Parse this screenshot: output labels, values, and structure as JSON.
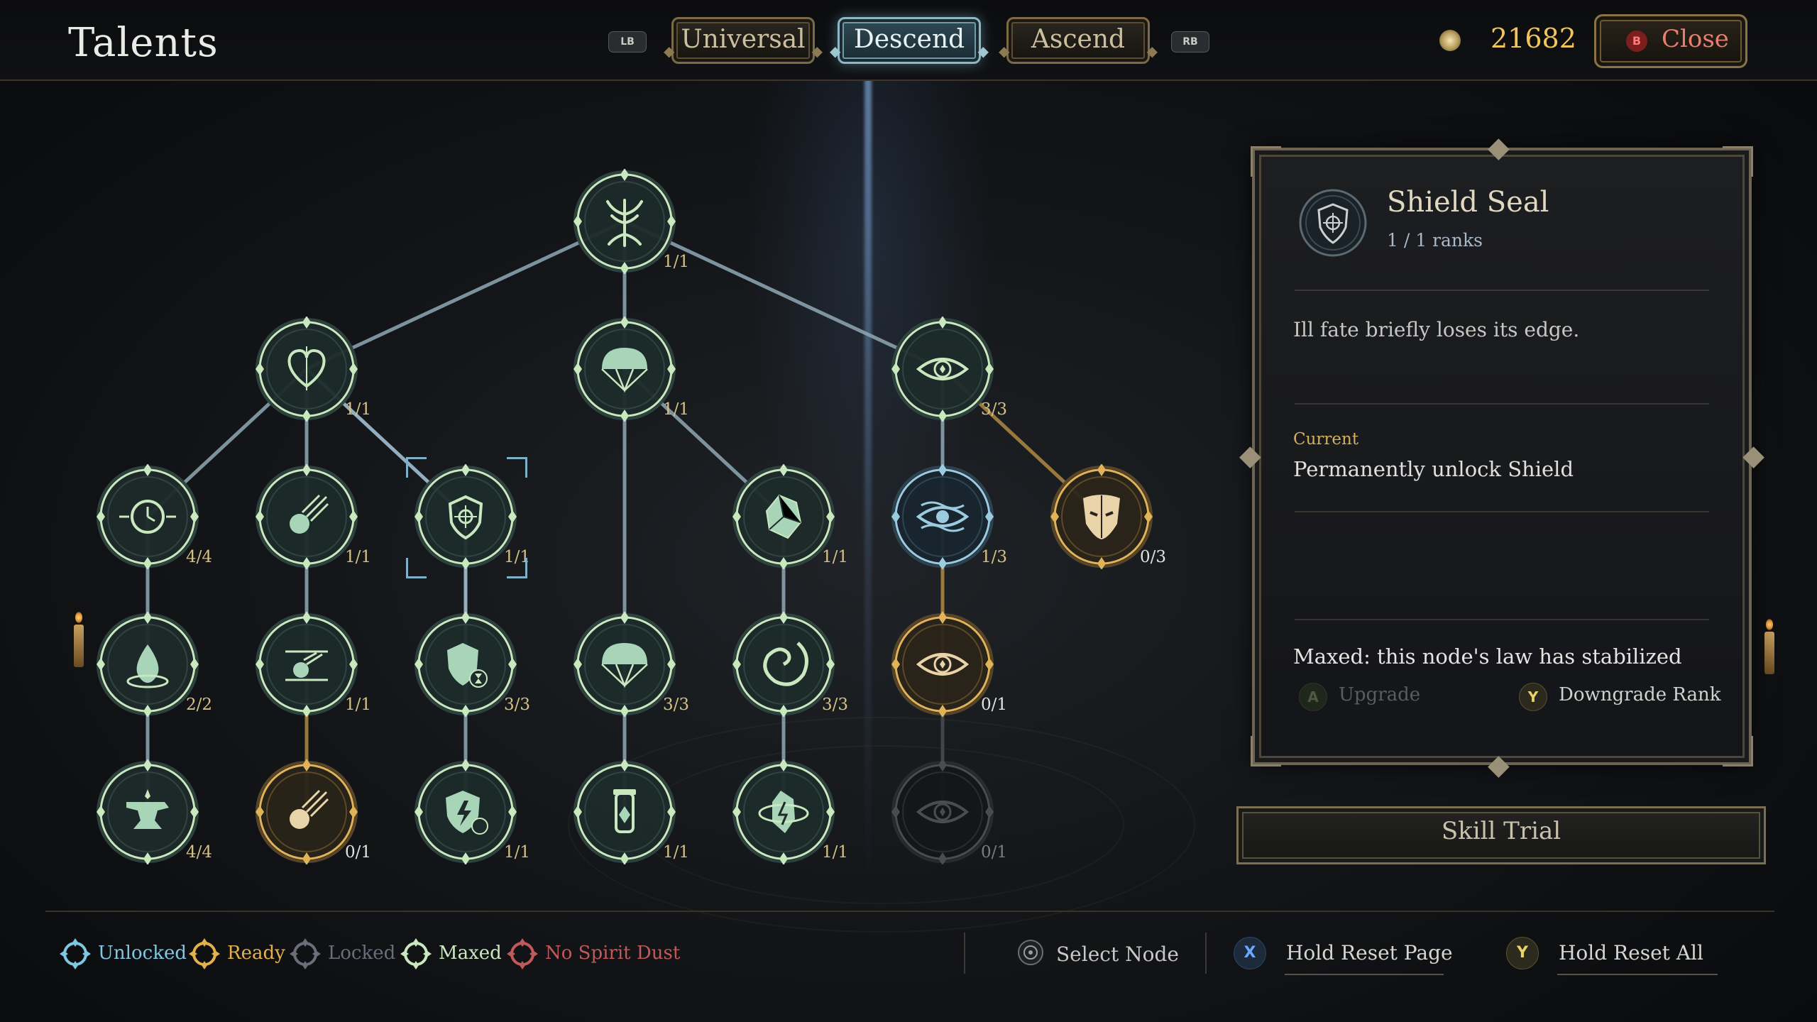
{
  "header": {
    "title": "Talents",
    "bumper_left": "LB",
    "bumper_right": "RB",
    "tabs": [
      {
        "label": "Universal",
        "active": false
      },
      {
        "label": "Descend",
        "active": true
      },
      {
        "label": "Ascend",
        "active": false
      }
    ],
    "currency_icon": "spirit-dust-icon",
    "currency_amount": "21682",
    "close_glyph": "B",
    "close_label": "Close"
  },
  "tree": {
    "nodes": [
      {
        "id": "root",
        "icon": "tree-roots-icon",
        "rank": "1/1",
        "state": "maxed"
      },
      {
        "id": "heart",
        "icon": "heart-icon",
        "rank": "1/1",
        "state": "maxed"
      },
      {
        "id": "parachute",
        "icon": "parachute-icon",
        "rank": "1/1",
        "state": "maxed"
      },
      {
        "id": "eye",
        "icon": "eye-icon",
        "rank": "3/3",
        "state": "maxed"
      },
      {
        "id": "clock",
        "icon": "clock-icon",
        "rank": "4/4",
        "state": "maxed"
      },
      {
        "id": "comet",
        "icon": "comet-icon",
        "rank": "1/1",
        "state": "maxed"
      },
      {
        "id": "shield-seal",
        "icon": "shield-seal-icon",
        "rank": "1/1",
        "state": "maxed",
        "selected": true
      },
      {
        "id": "crystal",
        "icon": "crystal-icon",
        "rank": "1/1",
        "state": "maxed"
      },
      {
        "id": "wave-eye",
        "icon": "wave-eye-icon",
        "rank": "1/3",
        "state": "unlocked"
      },
      {
        "id": "mask",
        "icon": "mask-icon",
        "rank": "0/3",
        "state": "ready"
      },
      {
        "id": "drop",
        "icon": "water-drop-icon",
        "rank": "2/2",
        "state": "maxed"
      },
      {
        "id": "meteor",
        "icon": "meteor-icon",
        "rank": "1/1",
        "state": "maxed"
      },
      {
        "id": "shield-hourglass",
        "icon": "shield-hourglass-icon",
        "rank": "3/3",
        "state": "maxed"
      },
      {
        "id": "parachute-2",
        "icon": "parachute-icon",
        "rank": "3/3",
        "state": "maxed"
      },
      {
        "id": "vortex",
        "icon": "vortex-icon",
        "rank": "3/3",
        "state": "maxed"
      },
      {
        "id": "eye-gold",
        "icon": "eye-icon",
        "rank": "0/1",
        "state": "ready"
      },
      {
        "id": "anvil",
        "icon": "anvil-icon",
        "rank": "4/4",
        "state": "maxed"
      },
      {
        "id": "comet-gold",
        "icon": "comet-icon",
        "rank": "0/1",
        "state": "ready"
      },
      {
        "id": "shield-bolt",
        "icon": "shield-bolt-icon",
        "rank": "1/1",
        "state": "maxed"
      },
      {
        "id": "vial",
        "icon": "vial-icon",
        "rank": "1/1",
        "state": "maxed"
      },
      {
        "id": "crystal-orbit",
        "icon": "crystal-orbit-icon",
        "rank": "1/1",
        "state": "maxed"
      },
      {
        "id": "eye-locked",
        "icon": "eye-icon",
        "rank": "0/1",
        "state": "locked"
      }
    ]
  },
  "detail": {
    "icon": "shield-seal-icon",
    "title": "Shield Seal",
    "ranks": "1 / 1 ranks",
    "description": "Ill fate briefly loses its edge.",
    "current_label": "Current",
    "current_text": "Permanently unlock Shield",
    "maxed_text": "Maxed: this node's law has stabilized",
    "upgrade_glyph": "A",
    "upgrade_label": "Upgrade",
    "downgrade_glyph": "Y",
    "downgrade_label": "Downgrade Rank"
  },
  "skill_trial_label": "Skill Trial",
  "legend": [
    {
      "label": "Unlocked",
      "color": "#7ec8e3"
    },
    {
      "label": "Ready",
      "color": "#e3b04a"
    },
    {
      "label": "Locked",
      "color": "#6b6e78"
    },
    {
      "label": "Maxed",
      "color": "#c9e8c0"
    },
    {
      "label": "No Spirit Dust",
      "color": "#c05a5a"
    }
  ],
  "controls": {
    "select_node_icon": "left-stick-icon",
    "select_node_label": "Select Node",
    "reset_page_glyph": "X",
    "reset_page_label": "Hold Reset Page",
    "reset_all_glyph": "Y",
    "reset_all_label": "Hold Reset All"
  },
  "colors": {
    "maxed_ring": "#c9e8c0",
    "unlocked_ring": "#9ccbe0",
    "ready_ring": "#e0b35a",
    "locked_ring": "#4a4c52",
    "gold_text": "#f1c55a",
    "accent_teal": "#8fb6c2"
  }
}
